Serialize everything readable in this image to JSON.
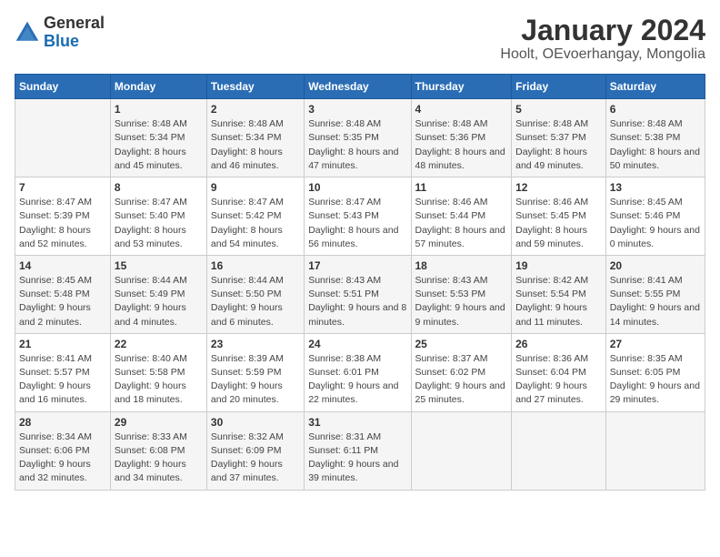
{
  "header": {
    "logo_general": "General",
    "logo_blue": "Blue",
    "title": "January 2024",
    "subtitle": "Hoolt, OEvoerhangay, Mongolia"
  },
  "columns": [
    "Sunday",
    "Monday",
    "Tuesday",
    "Wednesday",
    "Thursday",
    "Friday",
    "Saturday"
  ],
  "weeks": [
    [
      {
        "day": "",
        "sunrise": "",
        "sunset": "",
        "daylight": ""
      },
      {
        "day": "1",
        "sunrise": "Sunrise: 8:48 AM",
        "sunset": "Sunset: 5:34 PM",
        "daylight": "Daylight: 8 hours and 45 minutes."
      },
      {
        "day": "2",
        "sunrise": "Sunrise: 8:48 AM",
        "sunset": "Sunset: 5:34 PM",
        "daylight": "Daylight: 8 hours and 46 minutes."
      },
      {
        "day": "3",
        "sunrise": "Sunrise: 8:48 AM",
        "sunset": "Sunset: 5:35 PM",
        "daylight": "Daylight: 8 hours and 47 minutes."
      },
      {
        "day": "4",
        "sunrise": "Sunrise: 8:48 AM",
        "sunset": "Sunset: 5:36 PM",
        "daylight": "Daylight: 8 hours and 48 minutes."
      },
      {
        "day": "5",
        "sunrise": "Sunrise: 8:48 AM",
        "sunset": "Sunset: 5:37 PM",
        "daylight": "Daylight: 8 hours and 49 minutes."
      },
      {
        "day": "6",
        "sunrise": "Sunrise: 8:48 AM",
        "sunset": "Sunset: 5:38 PM",
        "daylight": "Daylight: 8 hours and 50 minutes."
      }
    ],
    [
      {
        "day": "7",
        "sunrise": "Sunrise: 8:47 AM",
        "sunset": "Sunset: 5:39 PM",
        "daylight": "Daylight: 8 hours and 52 minutes."
      },
      {
        "day": "8",
        "sunrise": "Sunrise: 8:47 AM",
        "sunset": "Sunset: 5:40 PM",
        "daylight": "Daylight: 8 hours and 53 minutes."
      },
      {
        "day": "9",
        "sunrise": "Sunrise: 8:47 AM",
        "sunset": "Sunset: 5:42 PM",
        "daylight": "Daylight: 8 hours and 54 minutes."
      },
      {
        "day": "10",
        "sunrise": "Sunrise: 8:47 AM",
        "sunset": "Sunset: 5:43 PM",
        "daylight": "Daylight: 8 hours and 56 minutes."
      },
      {
        "day": "11",
        "sunrise": "Sunrise: 8:46 AM",
        "sunset": "Sunset: 5:44 PM",
        "daylight": "Daylight: 8 hours and 57 minutes."
      },
      {
        "day": "12",
        "sunrise": "Sunrise: 8:46 AM",
        "sunset": "Sunset: 5:45 PM",
        "daylight": "Daylight: 8 hours and 59 minutes."
      },
      {
        "day": "13",
        "sunrise": "Sunrise: 8:45 AM",
        "sunset": "Sunset: 5:46 PM",
        "daylight": "Daylight: 9 hours and 0 minutes."
      }
    ],
    [
      {
        "day": "14",
        "sunrise": "Sunrise: 8:45 AM",
        "sunset": "Sunset: 5:48 PM",
        "daylight": "Daylight: 9 hours and 2 minutes."
      },
      {
        "day": "15",
        "sunrise": "Sunrise: 8:44 AM",
        "sunset": "Sunset: 5:49 PM",
        "daylight": "Daylight: 9 hours and 4 minutes."
      },
      {
        "day": "16",
        "sunrise": "Sunrise: 8:44 AM",
        "sunset": "Sunset: 5:50 PM",
        "daylight": "Daylight: 9 hours and 6 minutes."
      },
      {
        "day": "17",
        "sunrise": "Sunrise: 8:43 AM",
        "sunset": "Sunset: 5:51 PM",
        "daylight": "Daylight: 9 hours and 8 minutes."
      },
      {
        "day": "18",
        "sunrise": "Sunrise: 8:43 AM",
        "sunset": "Sunset: 5:53 PM",
        "daylight": "Daylight: 9 hours and 9 minutes."
      },
      {
        "day": "19",
        "sunrise": "Sunrise: 8:42 AM",
        "sunset": "Sunset: 5:54 PM",
        "daylight": "Daylight: 9 hours and 11 minutes."
      },
      {
        "day": "20",
        "sunrise": "Sunrise: 8:41 AM",
        "sunset": "Sunset: 5:55 PM",
        "daylight": "Daylight: 9 hours and 14 minutes."
      }
    ],
    [
      {
        "day": "21",
        "sunrise": "Sunrise: 8:41 AM",
        "sunset": "Sunset: 5:57 PM",
        "daylight": "Daylight: 9 hours and 16 minutes."
      },
      {
        "day": "22",
        "sunrise": "Sunrise: 8:40 AM",
        "sunset": "Sunset: 5:58 PM",
        "daylight": "Daylight: 9 hours and 18 minutes."
      },
      {
        "day": "23",
        "sunrise": "Sunrise: 8:39 AM",
        "sunset": "Sunset: 5:59 PM",
        "daylight": "Daylight: 9 hours and 20 minutes."
      },
      {
        "day": "24",
        "sunrise": "Sunrise: 8:38 AM",
        "sunset": "Sunset: 6:01 PM",
        "daylight": "Daylight: 9 hours and 22 minutes."
      },
      {
        "day": "25",
        "sunrise": "Sunrise: 8:37 AM",
        "sunset": "Sunset: 6:02 PM",
        "daylight": "Daylight: 9 hours and 25 minutes."
      },
      {
        "day": "26",
        "sunrise": "Sunrise: 8:36 AM",
        "sunset": "Sunset: 6:04 PM",
        "daylight": "Daylight: 9 hours and 27 minutes."
      },
      {
        "day": "27",
        "sunrise": "Sunrise: 8:35 AM",
        "sunset": "Sunset: 6:05 PM",
        "daylight": "Daylight: 9 hours and 29 minutes."
      }
    ],
    [
      {
        "day": "28",
        "sunrise": "Sunrise: 8:34 AM",
        "sunset": "Sunset: 6:06 PM",
        "daylight": "Daylight: 9 hours and 32 minutes."
      },
      {
        "day": "29",
        "sunrise": "Sunrise: 8:33 AM",
        "sunset": "Sunset: 6:08 PM",
        "daylight": "Daylight: 9 hours and 34 minutes."
      },
      {
        "day": "30",
        "sunrise": "Sunrise: 8:32 AM",
        "sunset": "Sunset: 6:09 PM",
        "daylight": "Daylight: 9 hours and 37 minutes."
      },
      {
        "day": "31",
        "sunrise": "Sunrise: 8:31 AM",
        "sunset": "Sunset: 6:11 PM",
        "daylight": "Daylight: 9 hours and 39 minutes."
      },
      {
        "day": "",
        "sunrise": "",
        "sunset": "",
        "daylight": ""
      },
      {
        "day": "",
        "sunrise": "",
        "sunset": "",
        "daylight": ""
      },
      {
        "day": "",
        "sunrise": "",
        "sunset": "",
        "daylight": ""
      }
    ]
  ]
}
